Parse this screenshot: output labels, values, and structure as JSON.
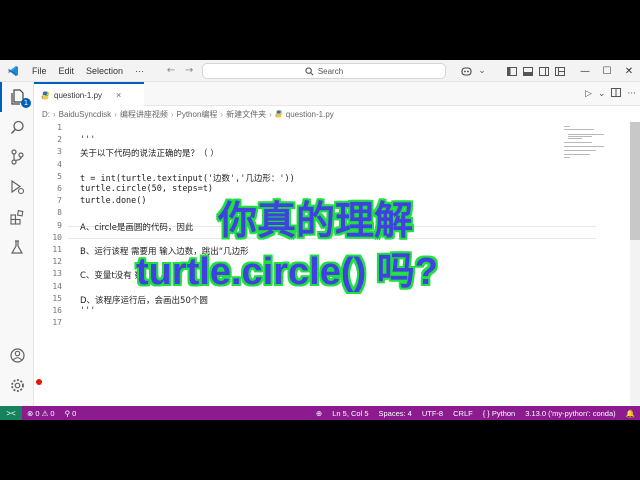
{
  "titlebar": {
    "menus": [
      "File",
      "Edit",
      "Selection",
      "···"
    ],
    "search_placeholder": "Search"
  },
  "activitybar": {
    "explorer_badge": "1"
  },
  "tab": {
    "filename": "question-1.py",
    "close": "×"
  },
  "breadcrumb": [
    "D:",
    "BaiduSyncdisk",
    "编程讲座视频",
    "Python编程",
    "新建文件夹",
    "question-1.py"
  ],
  "editor": {
    "lines": [
      {
        "n": "1",
        "text": ""
      },
      {
        "n": "2",
        "text": "'''"
      },
      {
        "n": "3",
        "text": "关于以下代码的说法正确的是？（ ）"
      },
      {
        "n": "4",
        "text": ""
      },
      {
        "n": "5",
        "text": "    t = int(turtle.textinput('边数','几边形：'))"
      },
      {
        "n": "6",
        "text": "    turtle.circle(50, steps=t)"
      },
      {
        "n": "7",
        "text": "    turtle.done()"
      },
      {
        "n": "8",
        "text": ""
      },
      {
        "n": "9",
        "text": "A、circle是画圆的代码，因此"
      },
      {
        "n": "10",
        "text": ""
      },
      {
        "n": "11",
        "text": "B、运行该程    需要用    输入边数，跳出“几边形"
      },
      {
        "n": "12",
        "text": ""
      },
      {
        "n": "13",
        "text": "C、变量t没有                    数"
      },
      {
        "n": "14",
        "text": ""
      },
      {
        "n": "15",
        "text": "D、该程序运行后，会画出50个圆"
      },
      {
        "n": "16",
        "text": "'''"
      },
      {
        "n": "17",
        "text": ""
      }
    ]
  },
  "overlay": {
    "line1": "你真的理解",
    "line2": "turtle.circle() 吗?"
  },
  "statusbar": {
    "remote": "><",
    "problems": "⊗ 0 ⚠ 0",
    "ports": "⚲ 0",
    "position": "Ln 5, Col 5",
    "spaces": "Spaces: 4",
    "encoding": "UTF-8",
    "eol": "CRLF",
    "language": "{ } Python",
    "interpreter": "3.13.0 ('my-python': conda)",
    "bell": "🔔"
  }
}
